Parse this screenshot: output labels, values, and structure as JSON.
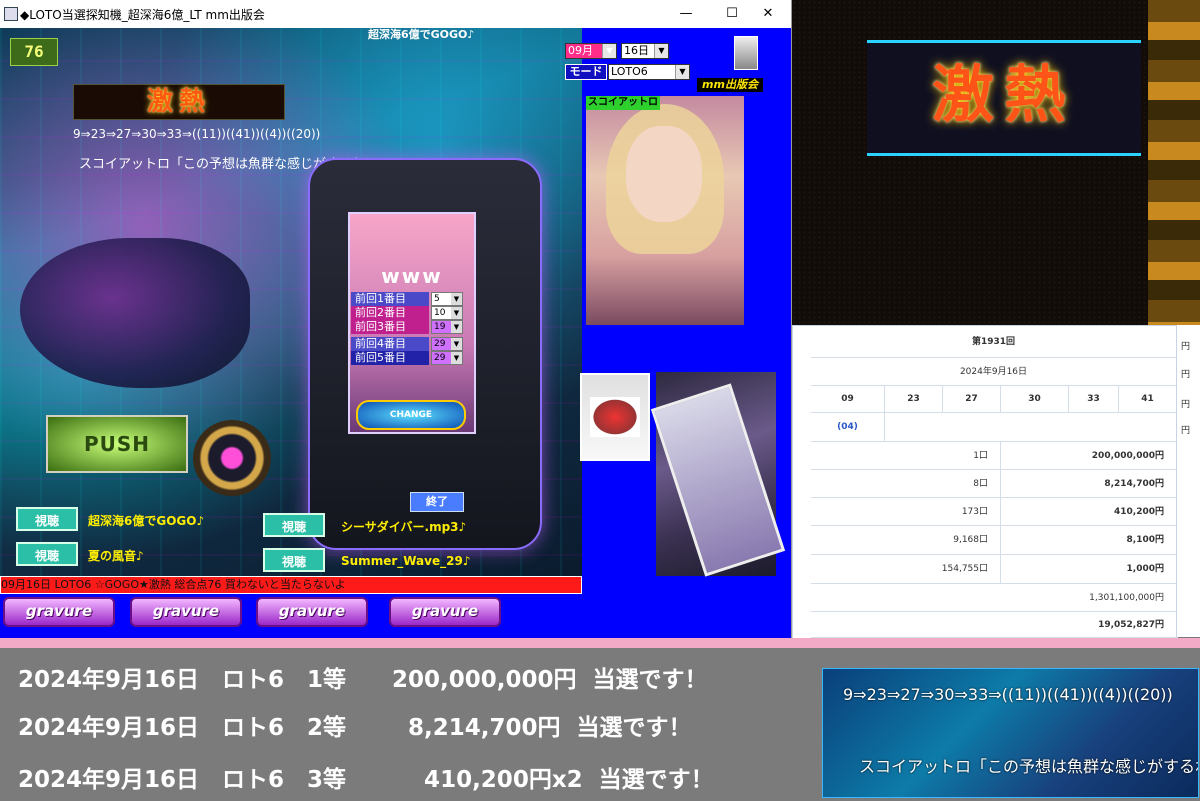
{
  "window": {
    "title": "◆LOTO当選探知機_超深海6億_LT  mm出版会",
    "min": "—",
    "max": "☐",
    "close": "✕"
  },
  "scene": {
    "logo": "76",
    "banner": "超深海6億でGOGO♪",
    "gekinetsu": "激熱",
    "numbers": "9⇒23⇒27⇒30⇒33⇒((11))((41))((4))((20))",
    "quote": "スコイアットロ「この予想は魚群な感じがするね!」",
    "www": "www",
    "push": "PUSH",
    "change": "CHANGE",
    "end": "終了",
    "prev_rows": [
      {
        "label": "前回1番目",
        "value": "5",
        "color": "#4a4ac8",
        "sel": "#ffffff"
      },
      {
        "label": "前回2番目",
        "value": "10",
        "color": "#c01f8e",
        "sel": "#ffffff"
      },
      {
        "label": "前回3番目",
        "value": "19",
        "color": "#c01f8e",
        "sel": "#d070ff"
      },
      {
        "label": "前回4番目",
        "value": "29",
        "color": "#4a4ac8",
        "sel": "#d070ff"
      },
      {
        "label": "前回5番目",
        "value": "29",
        "color": "#2222a8",
        "sel": "#d070ff"
      }
    ],
    "watch": "視聴",
    "songs": [
      "超深海6億でGOGO♪",
      "夏の風音♪",
      "シーサダイバー.mp3♪",
      "Summer_Wave_29♪"
    ],
    "ticker": "09月16日 LOTO6 ☆GOGO★激熱 総合点76  買わないと当たらないよ",
    "gravure": "gravure"
  },
  "controls": {
    "month": "09月",
    "day": "16日",
    "mode_label": "モード",
    "mode_value": "LOTO6",
    "publisher": "mm出版会",
    "photo_tag": "スコイアットロ"
  },
  "results": {
    "round": "第1931回",
    "date": "2024年9月16日",
    "main_numbers": [
      "09",
      "23",
      "27",
      "30",
      "33",
      "41"
    ],
    "bonus": "(04)",
    "prizes": [
      {
        "count": "1口",
        "amount": "200,000,000円"
      },
      {
        "count": "8口",
        "amount": "8,214,700円"
      },
      {
        "count": "173口",
        "amount": "410,200円"
      },
      {
        "count": "9,168口",
        "amount": "8,100円"
      },
      {
        "count": "154,755口",
        "amount": "1,000円"
      }
    ],
    "carryover": "1,301,100,000円",
    "total": "19,052,827円",
    "cut": [
      "円",
      "円",
      "円",
      "円"
    ]
  },
  "wins": [
    "2024年9月16日　ロト6　1等　　200,000,000円  当選です！",
    "2024年9月16日　ロト6　2等　　  8,214,700円  当選です！",
    "2024年9月16日　ロト6　3等　　    410,200円x2  当選です！"
  ],
  "panel2": {
    "numbers": "9⇒23⇒27⇒30⇒33⇒((11))((41))((4))((20))",
    "quote": "スコイアットロ「この予想は魚群な感じがするね!」"
  }
}
